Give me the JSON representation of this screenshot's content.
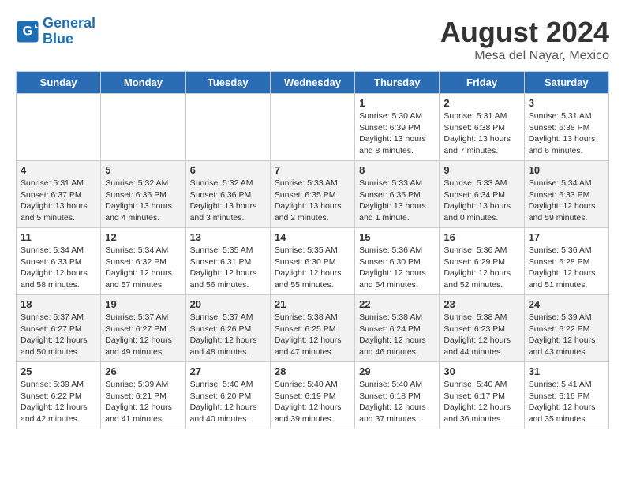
{
  "header": {
    "logo_line1": "General",
    "logo_line2": "Blue",
    "title": "August 2024",
    "subtitle": "Mesa del Nayar, Mexico"
  },
  "days_of_week": [
    "Sunday",
    "Monday",
    "Tuesday",
    "Wednesday",
    "Thursday",
    "Friday",
    "Saturday"
  ],
  "weeks": [
    [
      {
        "num": "",
        "info": ""
      },
      {
        "num": "",
        "info": ""
      },
      {
        "num": "",
        "info": ""
      },
      {
        "num": "",
        "info": ""
      },
      {
        "num": "1",
        "info": "Sunrise: 5:30 AM\nSunset: 6:39 PM\nDaylight: 13 hours\nand 8 minutes."
      },
      {
        "num": "2",
        "info": "Sunrise: 5:31 AM\nSunset: 6:38 PM\nDaylight: 13 hours\nand 7 minutes."
      },
      {
        "num": "3",
        "info": "Sunrise: 5:31 AM\nSunset: 6:38 PM\nDaylight: 13 hours\nand 6 minutes."
      }
    ],
    [
      {
        "num": "4",
        "info": "Sunrise: 5:31 AM\nSunset: 6:37 PM\nDaylight: 13 hours\nand 5 minutes."
      },
      {
        "num": "5",
        "info": "Sunrise: 5:32 AM\nSunset: 6:36 PM\nDaylight: 13 hours\nand 4 minutes."
      },
      {
        "num": "6",
        "info": "Sunrise: 5:32 AM\nSunset: 6:36 PM\nDaylight: 13 hours\nand 3 minutes."
      },
      {
        "num": "7",
        "info": "Sunrise: 5:33 AM\nSunset: 6:35 PM\nDaylight: 13 hours\nand 2 minutes."
      },
      {
        "num": "8",
        "info": "Sunrise: 5:33 AM\nSunset: 6:35 PM\nDaylight: 13 hours\nand 1 minute."
      },
      {
        "num": "9",
        "info": "Sunrise: 5:33 AM\nSunset: 6:34 PM\nDaylight: 13 hours\nand 0 minutes."
      },
      {
        "num": "10",
        "info": "Sunrise: 5:34 AM\nSunset: 6:33 PM\nDaylight: 12 hours\nand 59 minutes."
      }
    ],
    [
      {
        "num": "11",
        "info": "Sunrise: 5:34 AM\nSunset: 6:33 PM\nDaylight: 12 hours\nand 58 minutes."
      },
      {
        "num": "12",
        "info": "Sunrise: 5:34 AM\nSunset: 6:32 PM\nDaylight: 12 hours\nand 57 minutes."
      },
      {
        "num": "13",
        "info": "Sunrise: 5:35 AM\nSunset: 6:31 PM\nDaylight: 12 hours\nand 56 minutes."
      },
      {
        "num": "14",
        "info": "Sunrise: 5:35 AM\nSunset: 6:30 PM\nDaylight: 12 hours\nand 55 minutes."
      },
      {
        "num": "15",
        "info": "Sunrise: 5:36 AM\nSunset: 6:30 PM\nDaylight: 12 hours\nand 54 minutes."
      },
      {
        "num": "16",
        "info": "Sunrise: 5:36 AM\nSunset: 6:29 PM\nDaylight: 12 hours\nand 52 minutes."
      },
      {
        "num": "17",
        "info": "Sunrise: 5:36 AM\nSunset: 6:28 PM\nDaylight: 12 hours\nand 51 minutes."
      }
    ],
    [
      {
        "num": "18",
        "info": "Sunrise: 5:37 AM\nSunset: 6:27 PM\nDaylight: 12 hours\nand 50 minutes."
      },
      {
        "num": "19",
        "info": "Sunrise: 5:37 AM\nSunset: 6:27 PM\nDaylight: 12 hours\nand 49 minutes."
      },
      {
        "num": "20",
        "info": "Sunrise: 5:37 AM\nSunset: 6:26 PM\nDaylight: 12 hours\nand 48 minutes."
      },
      {
        "num": "21",
        "info": "Sunrise: 5:38 AM\nSunset: 6:25 PM\nDaylight: 12 hours\nand 47 minutes."
      },
      {
        "num": "22",
        "info": "Sunrise: 5:38 AM\nSunset: 6:24 PM\nDaylight: 12 hours\nand 46 minutes."
      },
      {
        "num": "23",
        "info": "Sunrise: 5:38 AM\nSunset: 6:23 PM\nDaylight: 12 hours\nand 44 minutes."
      },
      {
        "num": "24",
        "info": "Sunrise: 5:39 AM\nSunset: 6:22 PM\nDaylight: 12 hours\nand 43 minutes."
      }
    ],
    [
      {
        "num": "25",
        "info": "Sunrise: 5:39 AM\nSunset: 6:22 PM\nDaylight: 12 hours\nand 42 minutes."
      },
      {
        "num": "26",
        "info": "Sunrise: 5:39 AM\nSunset: 6:21 PM\nDaylight: 12 hours\nand 41 minutes."
      },
      {
        "num": "27",
        "info": "Sunrise: 5:40 AM\nSunset: 6:20 PM\nDaylight: 12 hours\nand 40 minutes."
      },
      {
        "num": "28",
        "info": "Sunrise: 5:40 AM\nSunset: 6:19 PM\nDaylight: 12 hours\nand 39 minutes."
      },
      {
        "num": "29",
        "info": "Sunrise: 5:40 AM\nSunset: 6:18 PM\nDaylight: 12 hours\nand 37 minutes."
      },
      {
        "num": "30",
        "info": "Sunrise: 5:40 AM\nSunset: 6:17 PM\nDaylight: 12 hours\nand 36 minutes."
      },
      {
        "num": "31",
        "info": "Sunrise: 5:41 AM\nSunset: 6:16 PM\nDaylight: 12 hours\nand 35 minutes."
      }
    ]
  ]
}
